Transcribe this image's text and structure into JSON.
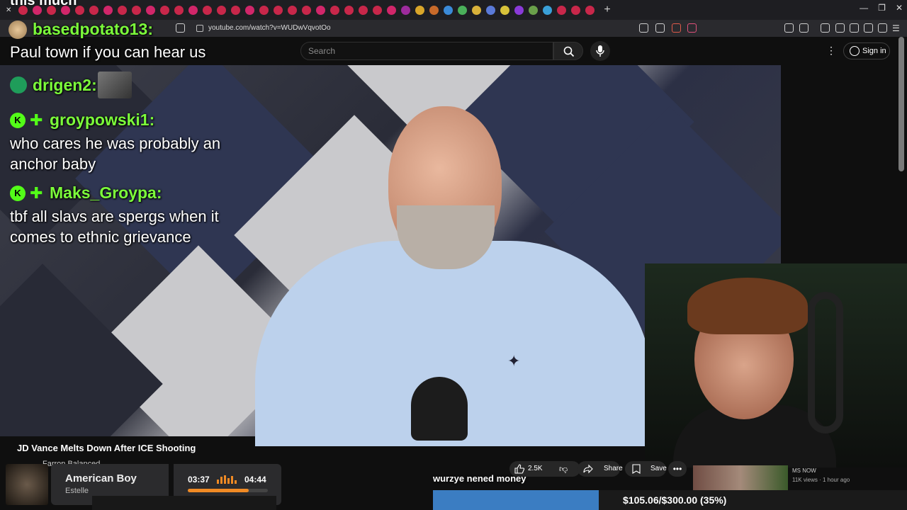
{
  "browser": {
    "url": "youtube.com/watch?v=WUDwVqvotOo",
    "tab_colors": [
      "#c8274a",
      "#d1266a",
      "#c8274a",
      "#d1266a",
      "#c8274a",
      "#c8274a",
      "#d1266a",
      "#c8274a",
      "#c8274a",
      "#d1266a",
      "#c8274a",
      "#c8274a",
      "#d1266a",
      "#c8274a",
      "#c8274a",
      "#c8274a",
      "#d1266a",
      "#c8274a",
      "#c8274a",
      "#c8274a",
      "#c8274a",
      "#d1266a",
      "#c8274a",
      "#c8274a",
      "#c8274a",
      "#c8274a",
      "#d1266a",
      "#9d2b9d",
      "#d9a62a",
      "#c86a2a",
      "#3a8ad8",
      "#4ab05a",
      "#d8b13a",
      "#5a7ad8",
      "#d8c23a",
      "#8a3ad8",
      "#6aa04a",
      "#3aa0d8",
      "#c8274a",
      "#c8274a",
      "#c8274a"
    ],
    "new_tab": "+"
  },
  "youtube": {
    "search_placeholder": "Search",
    "sign_in": "Sign in",
    "video_title": "JD Vance Melts Down After ICE Shooting",
    "channel_partial": "Farron Balanced",
    "likes": "2.5K",
    "share": "Share",
    "save": "Save",
    "more": "•••",
    "rec_channel": "MS NOW",
    "rec_meta": "11K views · 1 hour ago"
  },
  "overlay": {
    "top_fragment": "this much",
    "chat": [
      {
        "user": "basedpotato13:",
        "message": "Paul town if you can hear us"
      },
      {
        "user": "drigen2:",
        "message": ""
      },
      {
        "user": "groypowski1:",
        "message_lines": [
          "who cares he was probably an",
          "anchor baby"
        ]
      },
      {
        "user": "Maks_Groypa:",
        "message_lines": [
          "tbf all slavs are spergs when it",
          "comes to ethnic grievance"
        ]
      }
    ],
    "kick_badge": "K",
    "subtitle": "wurzye nened money",
    "goal_text": "$105.06/$300.00 (35%)",
    "goal_fraction": 0.35
  },
  "music": {
    "title": "American Boy",
    "artist": "Estelle",
    "current_time": "03:37",
    "total_time": "04:44",
    "progress_fraction": 0.76,
    "accent": "#f08a24"
  }
}
